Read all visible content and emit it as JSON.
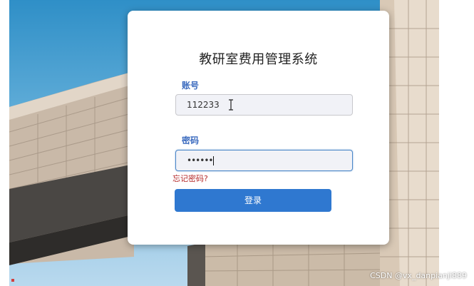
{
  "login": {
    "title": "教研室费用管理系统",
    "account_label": "账号",
    "account_value": "112233",
    "password_label": "密码",
    "password_masked": "••••••",
    "forgot_password": "忘记密码?",
    "login_button": "登录"
  },
  "watermark": "CSDN @vx_danpianji889",
  "colors": {
    "label_blue": "#3b6bbf",
    "button_blue": "#2f78d0",
    "forgot_red": "#b52b2b",
    "field_bg": "#f1f2f7"
  },
  "icons": {
    "text_cursor": "i-beam-cursor-icon"
  }
}
